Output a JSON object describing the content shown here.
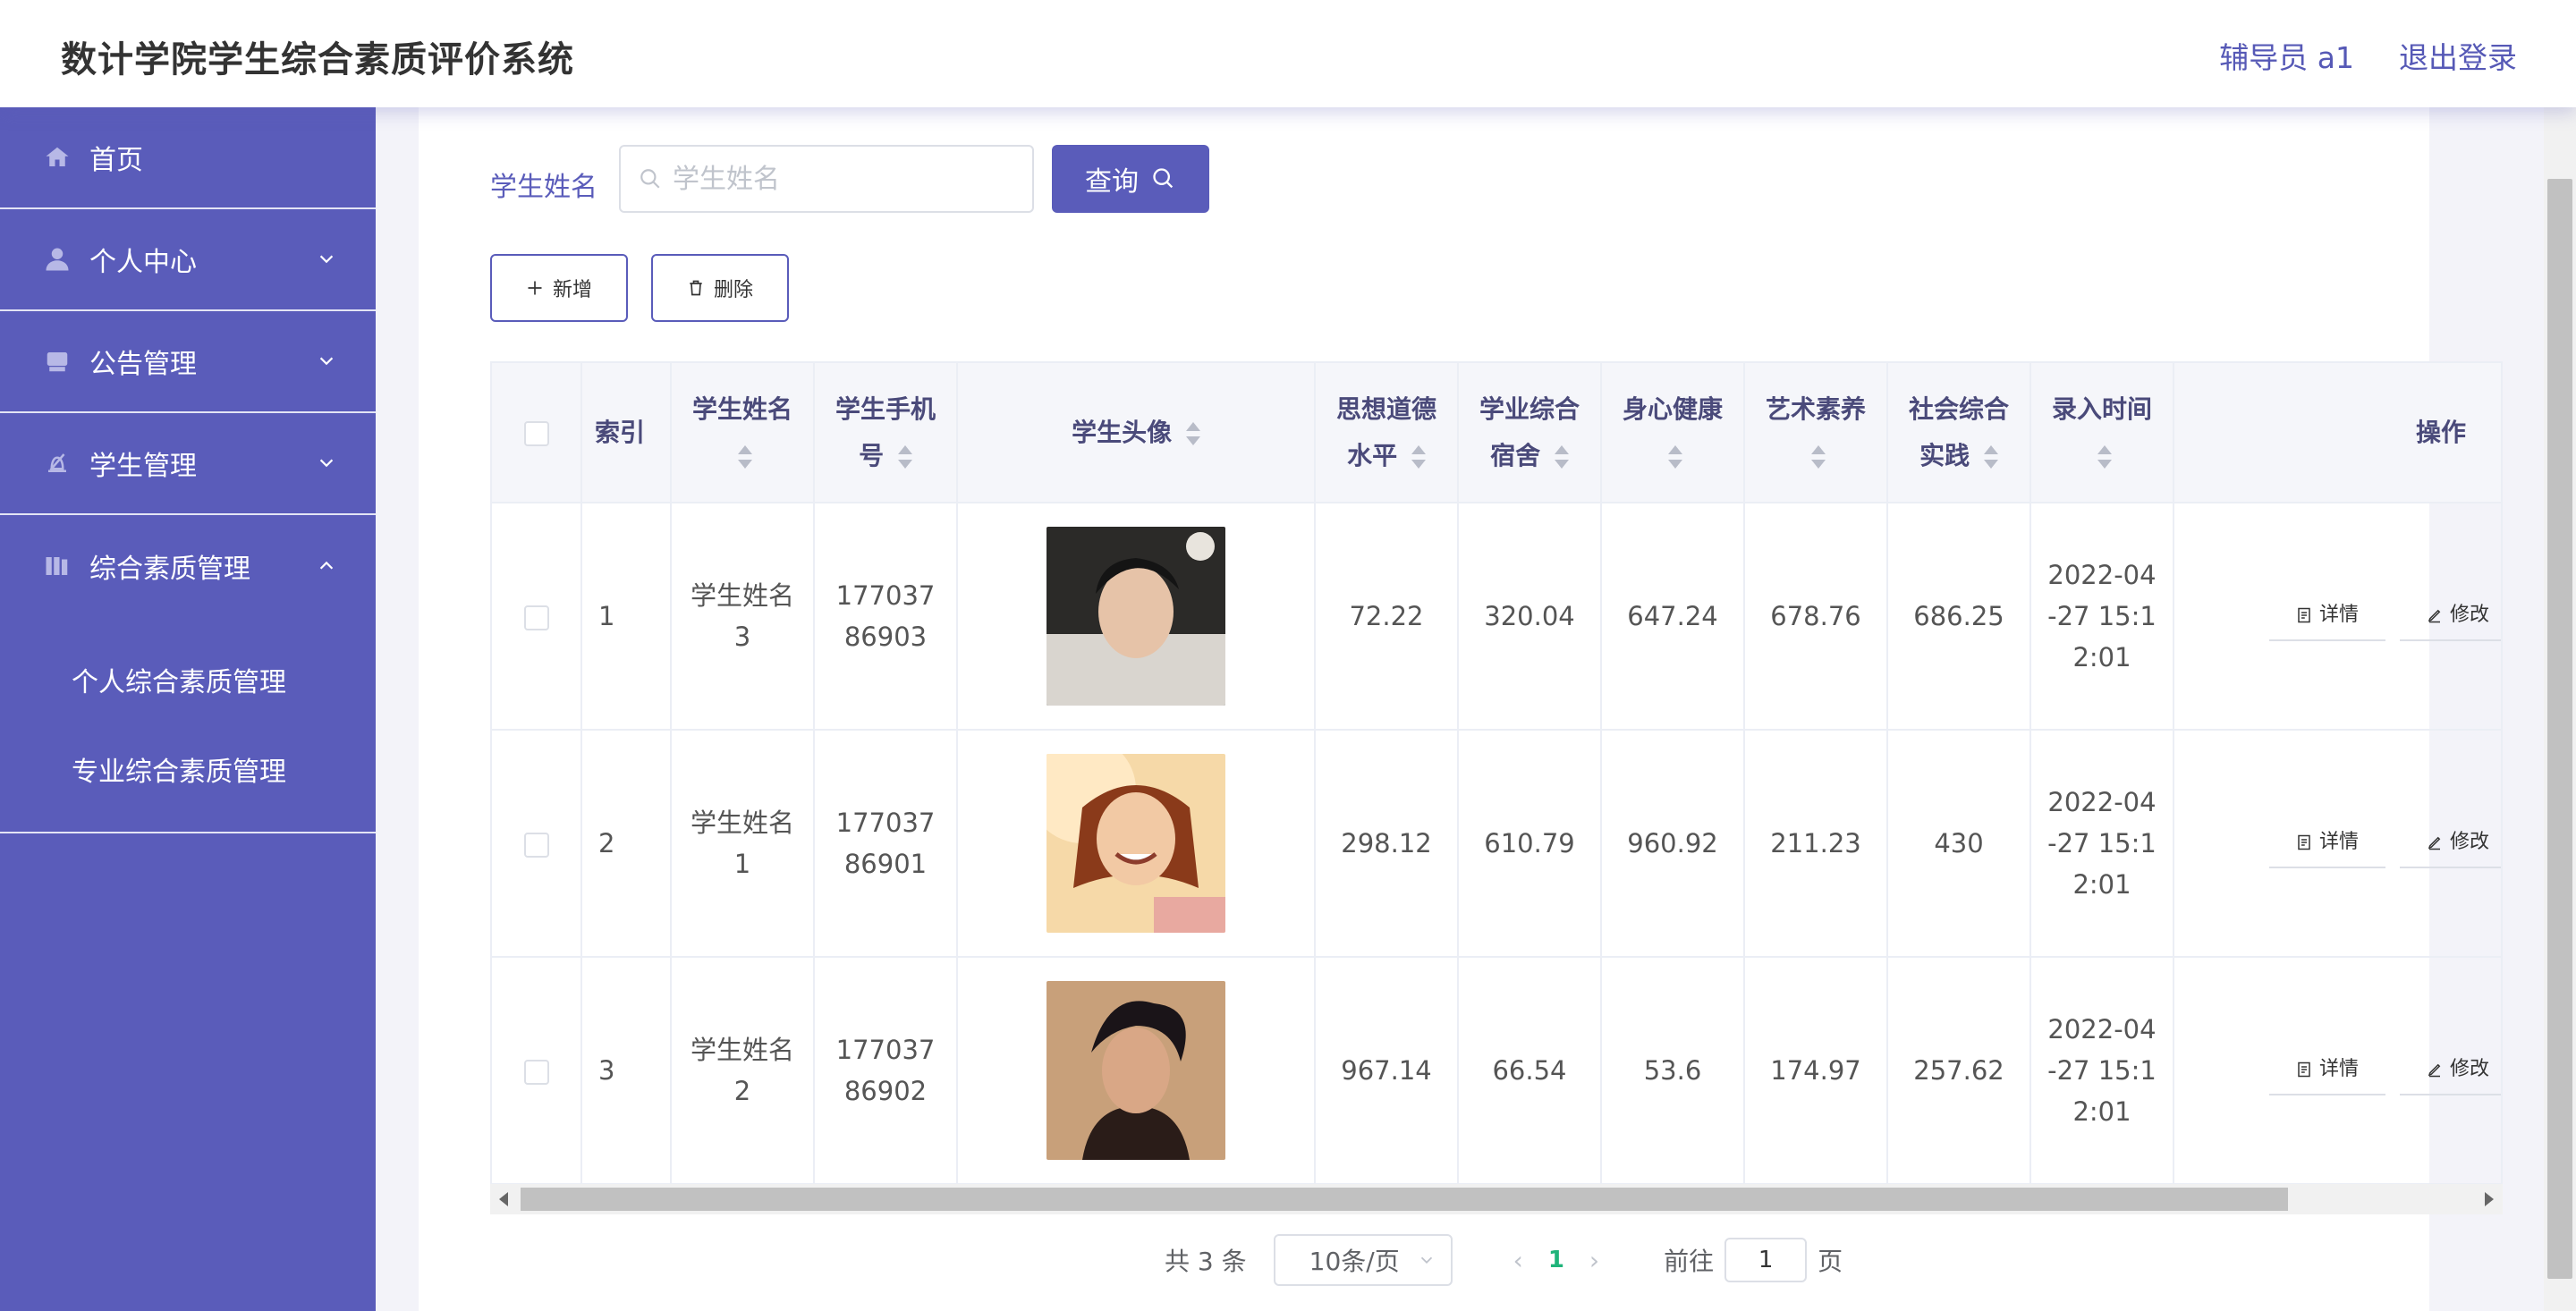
{
  "header": {
    "title": "数计学院学生综合素质评价系统",
    "user": "辅导员 a1",
    "logout": "退出登录"
  },
  "sidebar": {
    "items": [
      {
        "label": "首页",
        "icon": "home-icon"
      },
      {
        "label": "个人中心",
        "icon": "user-icon"
      },
      {
        "label": "公告管理",
        "icon": "notice-icon"
      },
      {
        "label": "学生管理",
        "icon": "student-icon"
      },
      {
        "label": "综合素质管理",
        "icon": "book-icon"
      }
    ],
    "subitems": [
      "个人综合素质管理",
      "专业综合素质管理"
    ]
  },
  "search": {
    "label": "学生姓名",
    "placeholder": "学生姓名",
    "button": "查询"
  },
  "toolbar": {
    "add": "新增",
    "delete": "删除"
  },
  "table": {
    "columns": [
      "索引",
      "学生姓名",
      "学生手机号",
      "学生头像",
      "思想道德水平",
      "学业综合宿舍",
      "身心健康",
      "艺术素养",
      "社会综合实践",
      "录入时间",
      "操作"
    ],
    "rows": [
      {
        "index": "1",
        "name": "学生姓名3",
        "phone": "17703786903",
        "moral": "72.22",
        "academic": "320.04",
        "health": "647.24",
        "art": "678.76",
        "social": "686.25",
        "time": "2022-04-27 15:12:01"
      },
      {
        "index": "2",
        "name": "学生姓名1",
        "phone": "17703786901",
        "moral": "298.12",
        "academic": "610.79",
        "health": "960.92",
        "art": "211.23",
        "social": "430",
        "time": "2022-04-27 15:12:01"
      },
      {
        "index": "3",
        "name": "学生姓名2",
        "phone": "17703786902",
        "moral": "967.14",
        "academic": "66.54",
        "health": "53.6",
        "art": "174.97",
        "social": "257.62",
        "time": "2022-04-27 15:12:01"
      }
    ],
    "detail": "详情",
    "edit": "修改"
  },
  "pagination": {
    "total": "共 3 条",
    "page_size": "10条/页",
    "current": "1",
    "goto_prefix": "前往",
    "goto_value": "1",
    "goto_suffix": "页"
  },
  "colors": {
    "accent": "#5a5cba",
    "active_page": "#1fb47a"
  }
}
